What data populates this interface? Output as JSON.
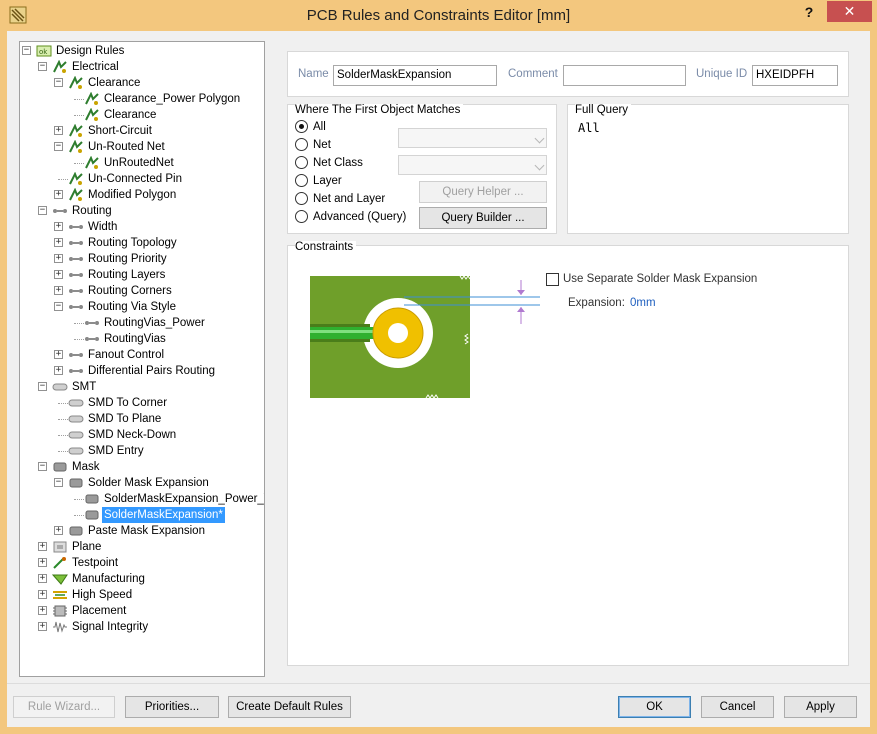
{
  "window": {
    "title": "PCB Rules and Constraints Editor [mm]",
    "help_label": "?",
    "close_label": "✕"
  },
  "tree": {
    "rows": [
      {
        "label": "Design Rules",
        "level": 0,
        "expander": "−",
        "icon": "design-rules-icon"
      },
      {
        "label": "Electrical",
        "level": 1,
        "expander": "−",
        "icon": "electrical-icon"
      },
      {
        "label": "Clearance",
        "level": 2,
        "expander": "−",
        "icon": "clearance-icon"
      },
      {
        "label": "Clearance_Power Polygon",
        "level": 3,
        "expander": "",
        "icon": "clearance-rule-icon"
      },
      {
        "label": "Clearance",
        "level": 3,
        "expander": "",
        "icon": "clearance-rule-icon"
      },
      {
        "label": "Short-Circuit",
        "level": 2,
        "expander": "+",
        "icon": "short-circuit-icon"
      },
      {
        "label": "Un-Routed Net",
        "level": 2,
        "expander": "−",
        "icon": "unrouted-net-icon"
      },
      {
        "label": "UnRoutedNet",
        "level": 3,
        "expander": "",
        "icon": "unrouted-rule-icon"
      },
      {
        "label": "Un-Connected Pin",
        "level": 2,
        "expander": "",
        "icon": "unconnected-pin-icon"
      },
      {
        "label": "Modified Polygon",
        "level": 2,
        "expander": "+",
        "icon": "modified-polygon-icon"
      },
      {
        "label": "Routing",
        "level": 1,
        "expander": "−",
        "icon": "routing-icon"
      },
      {
        "label": "Width",
        "level": 2,
        "expander": "+",
        "icon": "width-icon"
      },
      {
        "label": "Routing Topology",
        "level": 2,
        "expander": "+",
        "icon": "topology-icon"
      },
      {
        "label": "Routing Priority",
        "level": 2,
        "expander": "+",
        "icon": "priority-icon"
      },
      {
        "label": "Routing Layers",
        "level": 2,
        "expander": "+",
        "icon": "layers-icon"
      },
      {
        "label": "Routing Corners",
        "level": 2,
        "expander": "+",
        "icon": "corners-icon"
      },
      {
        "label": "Routing Via Style",
        "level": 2,
        "expander": "−",
        "icon": "via-style-icon"
      },
      {
        "label": "RoutingVias_Power",
        "level": 3,
        "expander": "",
        "icon": "via-rule-icon"
      },
      {
        "label": "RoutingVias",
        "level": 3,
        "expander": "",
        "icon": "via-rule-icon"
      },
      {
        "label": "Fanout Control",
        "level": 2,
        "expander": "+",
        "icon": "fanout-icon"
      },
      {
        "label": "Differential Pairs Routing",
        "level": 2,
        "expander": "+",
        "icon": "diff-pairs-icon"
      },
      {
        "label": "SMT",
        "level": 1,
        "expander": "−",
        "icon": "smt-icon"
      },
      {
        "label": "SMD To Corner",
        "level": 2,
        "expander": "",
        "icon": "smd-icon"
      },
      {
        "label": "SMD To Plane",
        "level": 2,
        "expander": "",
        "icon": "smd-icon"
      },
      {
        "label": "SMD Neck-Down",
        "level": 2,
        "expander": "",
        "icon": "smd-icon"
      },
      {
        "label": "SMD Entry",
        "level": 2,
        "expander": "",
        "icon": "smd-icon"
      },
      {
        "label": "Mask",
        "level": 1,
        "expander": "−",
        "icon": "mask-icon"
      },
      {
        "label": "Solder Mask Expansion",
        "level": 2,
        "expander": "−",
        "icon": "solder-mask-icon"
      },
      {
        "label": "SolderMaskExpansion_Power_Vi",
        "level": 3,
        "expander": "",
        "icon": "mask-rule-icon"
      },
      {
        "label": "SolderMaskExpansion*",
        "level": 3,
        "expander": "",
        "icon": "mask-rule-icon",
        "selected": true
      },
      {
        "label": "Paste Mask Expansion",
        "level": 2,
        "expander": "+",
        "icon": "paste-mask-icon"
      },
      {
        "label": "Plane",
        "level": 1,
        "expander": "+",
        "icon": "plane-icon"
      },
      {
        "label": "Testpoint",
        "level": 1,
        "expander": "+",
        "icon": "testpoint-icon"
      },
      {
        "label": "Manufacturing",
        "level": 1,
        "expander": "+",
        "icon": "manufacturing-icon"
      },
      {
        "label": "High Speed",
        "level": 1,
        "expander": "+",
        "icon": "high-speed-icon"
      },
      {
        "label": "Placement",
        "level": 1,
        "expander": "+",
        "icon": "placement-icon"
      },
      {
        "label": "Signal Integrity",
        "level": 1,
        "expander": "+",
        "icon": "signal-integrity-icon"
      }
    ]
  },
  "rule_header": {
    "name_label": "Name",
    "name_value": "SolderMaskExpansion",
    "comment_label": "Comment",
    "comment_value": "",
    "unique_id_label": "Unique ID",
    "unique_id_value": "HXEIDPFH"
  },
  "first_object": {
    "title": "Where The First Object Matches",
    "options": [
      {
        "label": "All",
        "checked": true
      },
      {
        "label": "Net",
        "checked": false
      },
      {
        "label": "Net Class",
        "checked": false
      },
      {
        "label": "Layer",
        "checked": false
      },
      {
        "label": "Net and Layer",
        "checked": false
      },
      {
        "label": "Advanced (Query)",
        "checked": false
      }
    ],
    "query_helper_label": "Query Helper ...",
    "query_builder_label": "Query Builder ..."
  },
  "full_query": {
    "title": "Full Query",
    "text": "All"
  },
  "constraints": {
    "title": "Constraints",
    "use_separate_label": "Use Separate Solder Mask Expansion",
    "use_separate_checked": false,
    "expansion_label": "Expansion:",
    "expansion_value": "0mm",
    "colors": {
      "board": "#6f9f2a",
      "pad": "#f0c000",
      "trace": "#2fb02f",
      "value": "#1e5fbf"
    }
  },
  "footer": {
    "rule_wizard_label": "Rule Wizard...",
    "priorities_label": "Priorities...",
    "create_default_label": "Create Default Rules",
    "ok_label": "OK",
    "cancel_label": "Cancel",
    "apply_label": "Apply"
  }
}
